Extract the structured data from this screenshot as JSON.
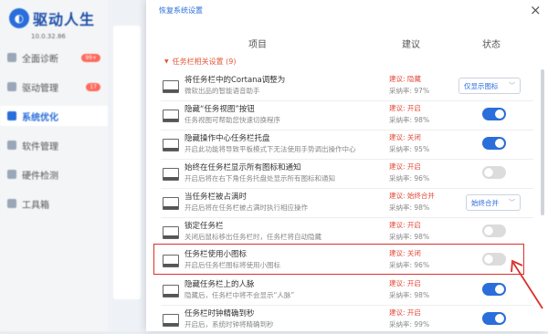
{
  "app": {
    "logo_text": "驱动人生",
    "version": "10.0.32.86",
    "nav": [
      {
        "label": "全面诊断",
        "badge": "99+"
      },
      {
        "label": "驱动管理",
        "badge": "17"
      },
      {
        "label": "系统优化",
        "badge": ""
      },
      {
        "label": "软件管理",
        "badge": ""
      },
      {
        "label": "硬件检测",
        "badge": ""
      },
      {
        "label": "工具箱",
        "badge": ""
      }
    ]
  },
  "dialog": {
    "restore_link": "恢复系统设置",
    "close_icon": "×",
    "headers": {
      "item": "项目",
      "suggestion": "建议",
      "status": "状态"
    },
    "group_label": "任务栏相关设置 (9)",
    "rows": [
      {
        "title": "将任务栏中的Cortana调整为",
        "desc": "微软出品的智能语音助手",
        "suggestion": "建议: 隐藏",
        "rate": "采纳率: 97%",
        "control": "select",
        "select_value": "仅显示图标"
      },
      {
        "title": "隐藏“任务视图”按钮",
        "desc": "任务视图可帮助您快速切换程序",
        "suggestion": "建议: 开启",
        "rate": "采纳率: 98%",
        "control": "toggle",
        "on": true
      },
      {
        "title": "隐藏操作中心任务栏托盘",
        "desc": "开启此功能将导致平板模式下无法使用手势调出操作中心",
        "suggestion": "建议: 关闭",
        "rate": "采纳率: 95%",
        "control": "toggle",
        "on": true
      },
      {
        "title": "始终在任务栏显示所有图标和通知",
        "desc": "开启后将在右下角任务托盘处显示所有图标和通知",
        "suggestion": "建议: 开启",
        "rate": "采纳率: 96%",
        "control": "toggle",
        "on": false
      },
      {
        "title": "当任务栏被占满时",
        "desc": "开启后将在任务栏被占满时执行相应操作",
        "suggestion": "建议: 始终合并",
        "rate": "采纳率: 98%",
        "control": "select",
        "select_value": "始终合并"
      },
      {
        "title": "锁定任务栏",
        "desc": "关闭后鼠标移出任务栏时，任务栏将自动隐藏",
        "suggestion": "建议: 开启",
        "rate": "采纳率: 98%",
        "control": "toggle",
        "on": false
      },
      {
        "title": "任务栏使用小图标",
        "desc": "开启后任务栏图标将使用小图标",
        "suggestion": "建议: 关闭",
        "rate": "采纳率: 96%",
        "control": "toggle",
        "on": false
      },
      {
        "title": "隐藏任务栏上的人脉",
        "desc": "隐藏后，任务栏中将不会显示“人脉”",
        "suggestion": "建议: 开启",
        "rate": "采纳率: 98%",
        "control": "toggle",
        "on": true
      },
      {
        "title": "任务栏时钟精确到秒",
        "desc": "开启后，系统时钟将精确到秒",
        "suggestion": "建议: 开启",
        "rate": "采纳率: 99%",
        "control": "toggle",
        "on": true
      }
    ]
  },
  "colors": {
    "accent": "#2a6edb",
    "warn": "#e24a3a",
    "highlight": "#d9302c"
  }
}
